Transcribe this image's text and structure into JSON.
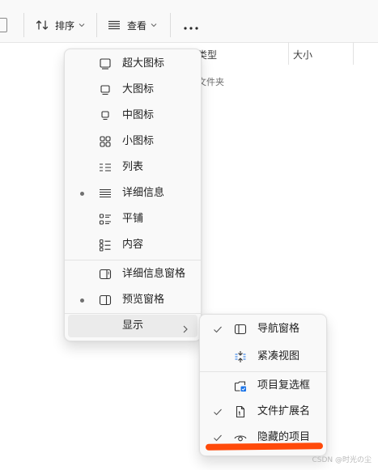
{
  "toolbar": {
    "sort_label": "排序",
    "view_label": "查看",
    "more_label": "..."
  },
  "columns": {
    "type": "类型",
    "size": "大小"
  },
  "row": {
    "type": "文件夹"
  },
  "view_menu": {
    "items": [
      {
        "label": "超大图标",
        "icon": "monitor-xl-icon"
      },
      {
        "label": "大图标",
        "icon": "monitor-large-icon"
      },
      {
        "label": "中图标",
        "icon": "monitor-medium-icon"
      },
      {
        "label": "小图标",
        "icon": "small-icons-grid-icon"
      },
      {
        "label": "列表",
        "icon": "list-icon"
      },
      {
        "label": "详细信息",
        "icon": "details-icon",
        "selected": true
      },
      {
        "label": "平铺",
        "icon": "tiles-icon"
      },
      {
        "label": "内容",
        "icon": "content-icon"
      },
      {
        "label": "详细信息窗格",
        "icon": "details-pane-icon"
      },
      {
        "label": "预览窗格",
        "icon": "preview-pane-icon",
        "selected": true
      },
      {
        "label": "显示",
        "icon": "",
        "submenu": true
      }
    ]
  },
  "show_menu": {
    "items": [
      {
        "label": "导航窗格",
        "icon": "navigation-pane-icon",
        "checked": true
      },
      {
        "label": "紧凑视图",
        "icon": "compact-view-icon",
        "checked": false
      },
      {
        "label": "项目复选框",
        "icon": "item-checkbox-icon",
        "checked": false
      },
      {
        "label": "文件扩展名",
        "icon": "file-extension-icon",
        "checked": true
      },
      {
        "label": "隐藏的项目",
        "icon": "eye-icon",
        "checked": true
      }
    ]
  },
  "colors": {
    "highlight": "#ebebeb",
    "accent": "#1a73e8",
    "annotation": "#ff4a0a"
  },
  "watermark": "CSDN @时光の尘"
}
